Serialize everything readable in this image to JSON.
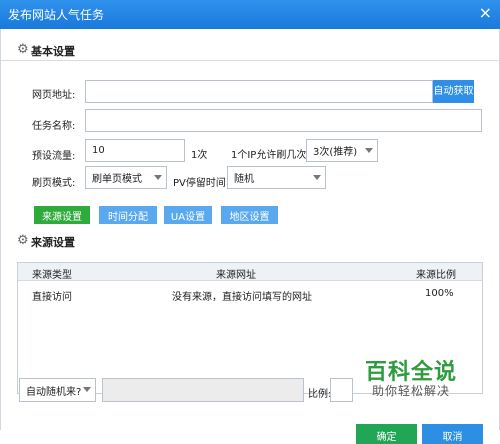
{
  "window": {
    "title": "发布网站人气任务",
    "close_icon": "×"
  },
  "basic": {
    "section_title": "基本设置",
    "url_label": "网页地址:",
    "url_value": "",
    "auto_fetch_label": "自动获取",
    "task_label": "任务名称:",
    "task_value": "",
    "preset_label": "预设流量:",
    "preset_value": "10",
    "preset_unit": "1次",
    "per_ip_label": "1个IP允许刷几次:",
    "per_ip_value": "3次(推荐)",
    "mode_label": "刷页模式:",
    "mode_value": "刷单页模式",
    "pv_label": "PV停留时间:",
    "pv_value": "随机"
  },
  "tabs": [
    {
      "label": "来源设置",
      "color": "#2faa3c"
    },
    {
      "label": "时间分配",
      "color": "#5aa9ef"
    },
    {
      "label": "UA设置",
      "color": "#5aa9ef"
    },
    {
      "label": "地区设置",
      "color": "#5aa9ef"
    }
  ],
  "source": {
    "section_title": "来源设置",
    "columns": [
      "来源类型",
      "来源网址",
      "来源比例"
    ],
    "rows": [
      {
        "type": "直接访问",
        "url": "没有来源，直接访问填写的网址",
        "ratio": "100%"
      }
    ],
    "bottom_select": "自动随机来?",
    "bottom_input": "",
    "ratio_label": "比例:",
    "ratio_value": ""
  },
  "watermark": {
    "big": "百科全说",
    "small": "助你轻松解决"
  },
  "footer": {
    "confirm": "确定",
    "cancel": "取消"
  }
}
